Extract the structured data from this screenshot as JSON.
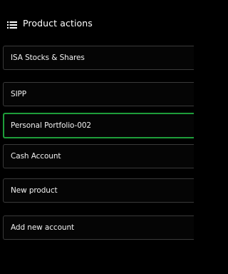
{
  "header": {
    "title": "Product actions",
    "icon": "list-menu-icon"
  },
  "items": [
    {
      "label": "ISA Stocks & Shares",
      "selected": false
    },
    {
      "label": "SIPP",
      "selected": false
    },
    {
      "label": "Personal Portfolio-002",
      "selected": true
    },
    {
      "label": "Cash Account",
      "selected": false
    },
    {
      "label": "New product",
      "selected": false
    },
    {
      "label": "Add new account",
      "selected": false
    }
  ],
  "colors": {
    "background": "#000000",
    "item_border": "#3a3a3a",
    "selected_border": "#1e9e3a",
    "text": "#ffffff"
  }
}
